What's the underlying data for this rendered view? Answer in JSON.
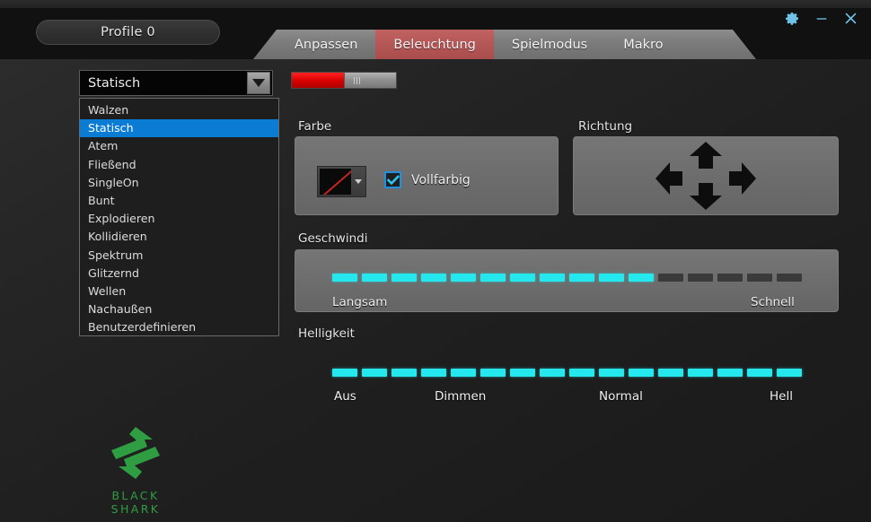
{
  "window": {
    "profile_label": "Profile 0",
    "controls": [
      {
        "name": "settings-gear",
        "icon": "gear-icon"
      },
      {
        "name": "minimize",
        "icon": "minimize-icon"
      },
      {
        "name": "close",
        "icon": "close-icon"
      }
    ]
  },
  "tabs": [
    {
      "label": "Anpassen",
      "active": false
    },
    {
      "label": "Beleuchtung",
      "active": true
    },
    {
      "label": "Spielmodus",
      "active": false
    },
    {
      "label": "Makro",
      "active": false
    }
  ],
  "effect_select": {
    "value": "Statisch",
    "expanded": true,
    "options": [
      "Walzen",
      "Statisch",
      "Atem",
      "Fließend",
      "SingleOn",
      "Bunt",
      "Explodieren",
      "Kollidieren",
      "Spektrum",
      "Glitzernd",
      "Wellen",
      "Nachaußen",
      "Benutzerdefinieren"
    ],
    "selected_index": 1
  },
  "preview_slider": {
    "value_percent": 49,
    "fill_color": "#d60000"
  },
  "color_section": {
    "title": "Farbe",
    "swatch": {
      "name": "no-color",
      "diagonal_color": "#c0261f"
    },
    "fullcolor": {
      "label": "Vollfarbig",
      "checked": true,
      "accent": "#1f90e0"
    }
  },
  "direction_section": {
    "title": "Richtung",
    "arrows": [
      "up-arrow",
      "left-arrow",
      "right-arrow",
      "down-arrow"
    ]
  },
  "speed_section": {
    "title": "Geschwindi",
    "min_label": "Langsam",
    "max_label": "Schnell",
    "segments_total": 16,
    "segments_on": 11,
    "on_color": "#25e8ee",
    "off_color": "#3a3a3a"
  },
  "brightness_section": {
    "title": "Helligkeit",
    "scale_labels": [
      "Aus",
      "Dimmen",
      "Normal",
      "Hell"
    ],
    "segments_total": 16,
    "segments_on": 16,
    "on_color": "#25e8ee"
  },
  "logo": {
    "text": "BLACK SHARK",
    "color": "#2f9e43"
  }
}
